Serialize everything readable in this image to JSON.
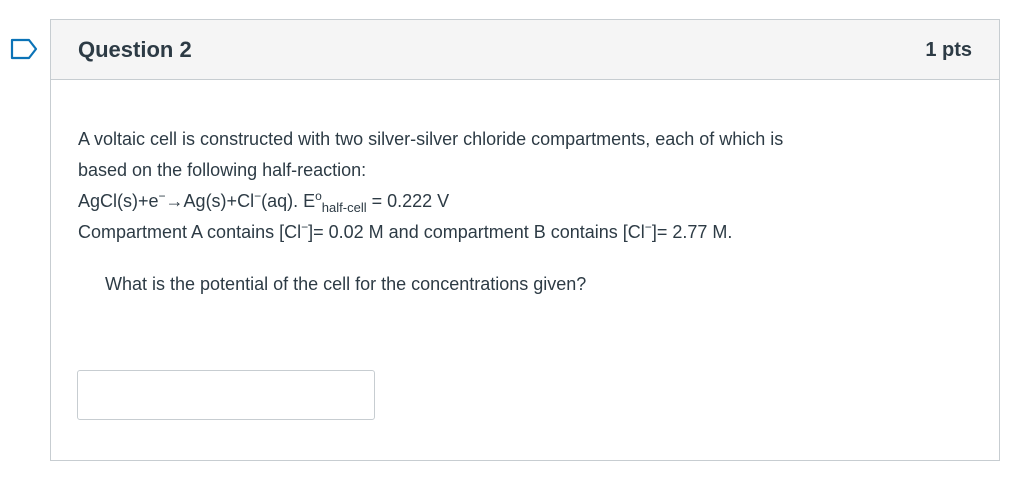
{
  "question": {
    "title": "Question 2",
    "points": "1 pts",
    "flag_icon": "bookmark-flag-icon",
    "body": {
      "line1": "A voltaic cell is constructed with two silver-silver chloride compartments, each of which is",
      "line2": "based on the following half-reaction:",
      "reaction": {
        "part1": "AgCl(s)+e",
        "sup1": "−",
        "part2": "→Ag(s)+Cl",
        "sup2": "−",
        "part3": "(aq). E",
        "sup3": "o",
        "sub1": "half-cell",
        "part4": " = 0.222 V"
      },
      "compartments": {
        "part1": "Compartment A contains [Cl",
        "sup1": "−",
        "part2": "]= 0.02 M and compartment B contains [Cl",
        "sup2": "−",
        "part3": "]= 2.77 M."
      }
    },
    "prompt": "What is the potential of the cell for the concentrations given?",
    "answer": {
      "value": "",
      "placeholder": ""
    }
  },
  "colors": {
    "text": "#2d3b45",
    "border": "#c7cdd1",
    "header_bg": "#f5f5f5",
    "flag": "#0b73b7"
  }
}
